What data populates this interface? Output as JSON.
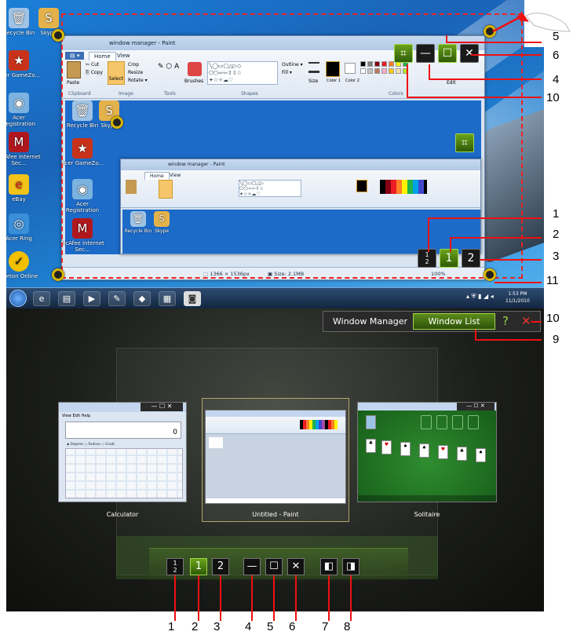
{
  "desktop": {
    "icons": [
      {
        "label": "Recycle Bin",
        "glyph": "🗑"
      },
      {
        "label": "Skype",
        "glyph": "S"
      },
      {
        "label": "Acer GameZo...",
        "glyph": "★"
      },
      {
        "label": "Acer Registration",
        "glyph": "◉"
      },
      {
        "label": "McAfee Internet Sec...",
        "glyph": "M"
      },
      {
        "label": "eBay",
        "glyph": "e"
      },
      {
        "label": "Acer Ring",
        "glyph": "◎"
      },
      {
        "label": "Norton Online",
        "glyph": "✓"
      }
    ],
    "clock": {
      "time": "1:53 PM",
      "date": "11/1/2010"
    }
  },
  "paint_window": {
    "title": "window manager - Paint",
    "tabs": [
      "Home",
      "View"
    ],
    "ribbon": {
      "paste": "Paste",
      "cut": "Cut",
      "copy": "Copy",
      "select": "Select",
      "crop": "Crop",
      "resize": "Resize",
      "rotate": "Rotate",
      "brushes": "Brushes",
      "outline": "Outline",
      "fill": "Fill",
      "size": "Size",
      "color1": "Color 1",
      "color2": "Color 2",
      "edit": "Edit",
      "groups": {
        "clipboard": "Clipboard",
        "image": "Image",
        "tools": "Tools",
        "shapes": "Shapes",
        "colors": "Colors"
      }
    },
    "canvas_icons": [
      {
        "label": "Recycle Bin"
      },
      {
        "label": "Skype"
      },
      {
        "label": "Acer GameZo..."
      },
      {
        "label": "Acer Registration"
      },
      {
        "label": "McAfee Internet Sec..."
      }
    ],
    "status": {
      "dimensions": "1366 × 1536px",
      "size": "Size: 2.1MB",
      "zoom": "100%"
    }
  },
  "inner_paint_window": {
    "title": "window manager - Paint"
  },
  "window_manager": {
    "title": "Window Manager",
    "window_list_label": "Window List",
    "help_glyph": "?",
    "close_glyph": "✕"
  },
  "window_list": [
    {
      "caption": "Calculator",
      "display": "0",
      "menu": [
        "View",
        "Edit",
        "Help"
      ],
      "options": [
        "Degrees",
        "Radians",
        "Grads"
      ]
    },
    {
      "caption": "Untitled - Paint"
    },
    {
      "caption": "Solitaire"
    }
  ],
  "controls": {
    "split_fraction_num": "1",
    "split_fraction_den": "2",
    "screen1": "1",
    "screen2": "2",
    "minimize": "—",
    "maximize": "☐",
    "close": "✕",
    "snap_left": "◧",
    "snap_right": "◨",
    "fit": "⌗"
  },
  "callouts": {
    "right": [
      "5",
      "6",
      "4",
      "10",
      "1",
      "2",
      "3",
      "11",
      "10",
      "9"
    ],
    "bottom": [
      "1",
      "2",
      "3",
      "4",
      "5",
      "6",
      "7",
      "8"
    ]
  },
  "colors": {
    "dashed": "#e22222",
    "accent_green": "#6aa31a",
    "callout_red": "#e11111"
  }
}
